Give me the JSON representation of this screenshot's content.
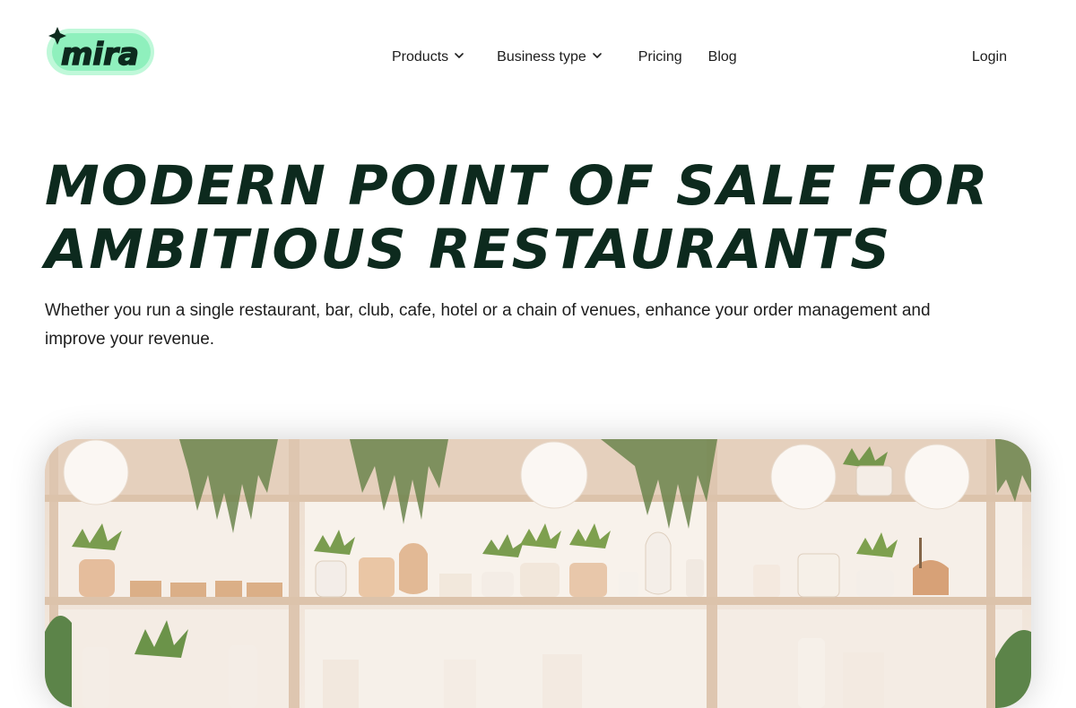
{
  "brand": {
    "logo_text": "mira",
    "logo_icon": "sparkle-icon",
    "accent_color": "#7ef2b4",
    "ink_color": "#0d2a1e"
  },
  "nav": {
    "items": [
      {
        "label": "Products",
        "has_dropdown": true,
        "icon": "chevron-down-icon"
      },
      {
        "label": "Business type",
        "has_dropdown": true,
        "icon": "chevron-down-icon"
      },
      {
        "label": "Pricing",
        "has_dropdown": false
      },
      {
        "label": "Blog",
        "has_dropdown": false
      }
    ],
    "login_label": "Login"
  },
  "hero": {
    "title_line1": "MODERN POINT OF SALE FOR",
    "title_line2": "AMBITIOUS RESTAURANTS",
    "subtitle": "Whether you run a single restaurant, bar, club, cafe, hotel or a chain of venues, enhance your order management and improve your revenue.",
    "image_alt": "Restaurant interior with shelves of potted plants, vases and pendant lamps"
  }
}
